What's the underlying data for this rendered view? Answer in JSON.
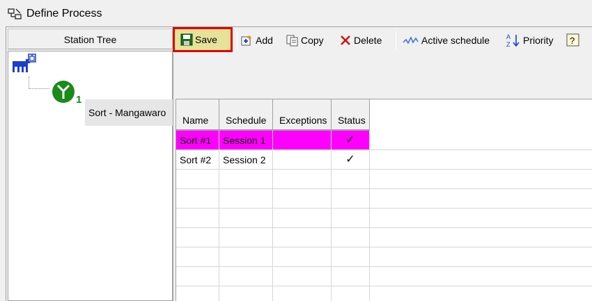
{
  "window": {
    "title": "Define Process"
  },
  "left_pane": {
    "header": "Station Tree",
    "node": {
      "label": "Sort - Mangawaro",
      "index": "1"
    }
  },
  "toolbar": {
    "save": "Save",
    "add": "Add",
    "copy": "Copy",
    "delete": "Delete",
    "active_schedule": "Active schedule",
    "priority": "Priority",
    "help": "?"
  },
  "grid": {
    "columns": [
      "Name",
      "Schedule",
      "Exceptions",
      "Status"
    ],
    "rows": [
      {
        "name": "Sort #1",
        "schedule": "Session 1",
        "exceptions": "",
        "status": "✓",
        "selected": true
      },
      {
        "name": "Sort #2",
        "schedule": "Session 2",
        "exceptions": "",
        "status": "✓",
        "selected": false
      }
    ]
  },
  "colors": {
    "selection": "#ff00ff",
    "highlight_border": "#e00000",
    "save_background": "#e6e29a",
    "tree_green": "#1a8a1a",
    "tree_blue": "#1a3fc8"
  }
}
